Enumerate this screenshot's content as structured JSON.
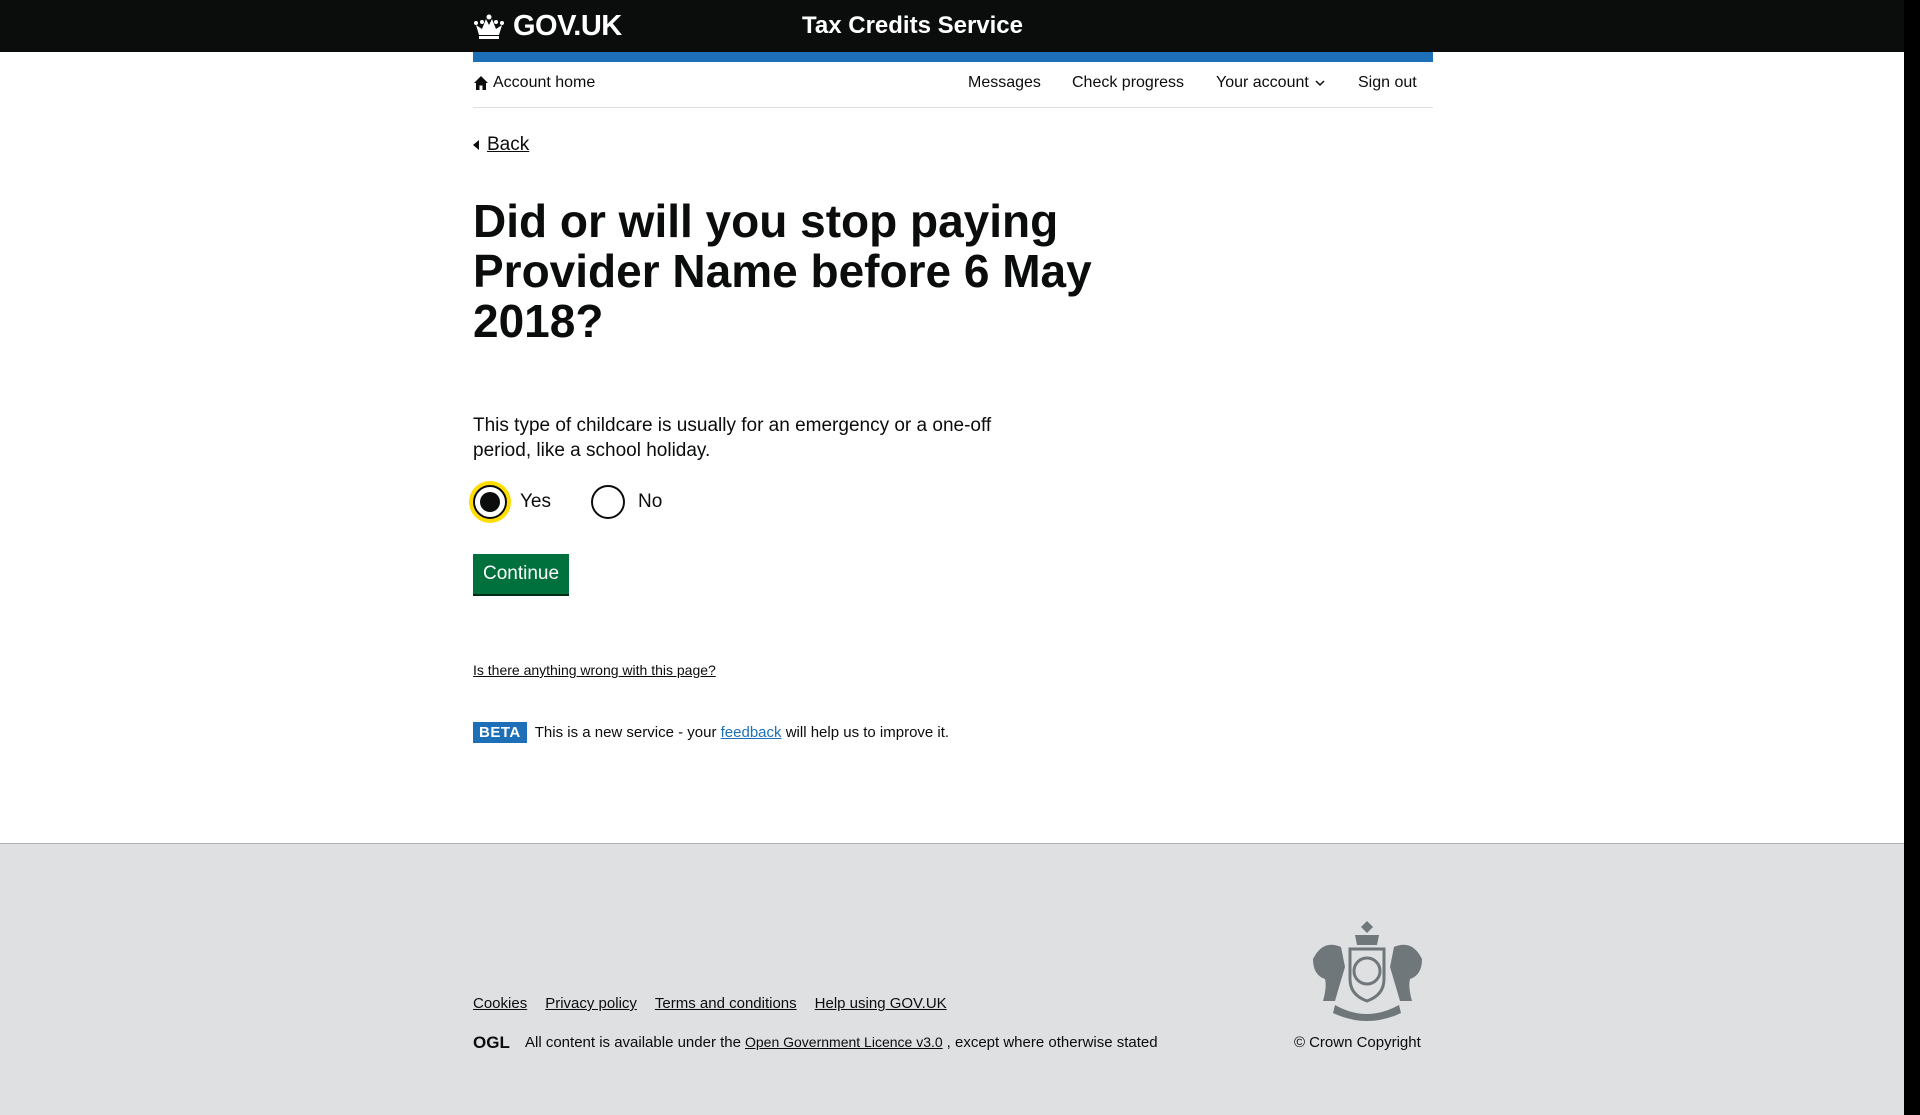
{
  "header": {
    "logo_text": "GOV.UK",
    "service_name": "Tax Credits Service",
    "bar_color": "#1d70b8"
  },
  "account_nav": {
    "home_label": "Account home",
    "messages": "Messages",
    "check_progress": "Check progress",
    "your_account": "Your account",
    "sign_out": "Sign out"
  },
  "back_link": "Back",
  "question": {
    "heading": "Did or will you stop paying Provider Name before 6 May 2018?",
    "hint": "This type of childcare is usually for an emergency or a one-off period, like a school holiday.",
    "options": [
      {
        "label": "Yes",
        "selected": true
      },
      {
        "label": "No",
        "selected": false
      }
    ]
  },
  "continue_label": "Continue",
  "report_link": "Is there anything wrong with this page?",
  "beta_banner": {
    "tag": "BETA",
    "text_before": "This is a new service  - your",
    "link": "feedback",
    "text_after": "will help us to improve it."
  },
  "footer": {
    "links": [
      "Cookies",
      "Privacy policy",
      "Terms and conditions",
      "Help using GOV.UK"
    ],
    "ogl_logo_text": "OGL",
    "licence_before": "All content is available under the",
    "licence_link": "Open Government Licence v3.0",
    "licence_after": ", except where otherwise stated",
    "copyright_symbol": "©",
    "copyright": "Crown Copyright",
    "background_color": "#dee0e2"
  },
  "colors": {
    "header_bg": "#0b0c0c",
    "button_green": "#00703c",
    "focus_yellow": "#ffdd00",
    "link_blue": "#1d70b8"
  }
}
